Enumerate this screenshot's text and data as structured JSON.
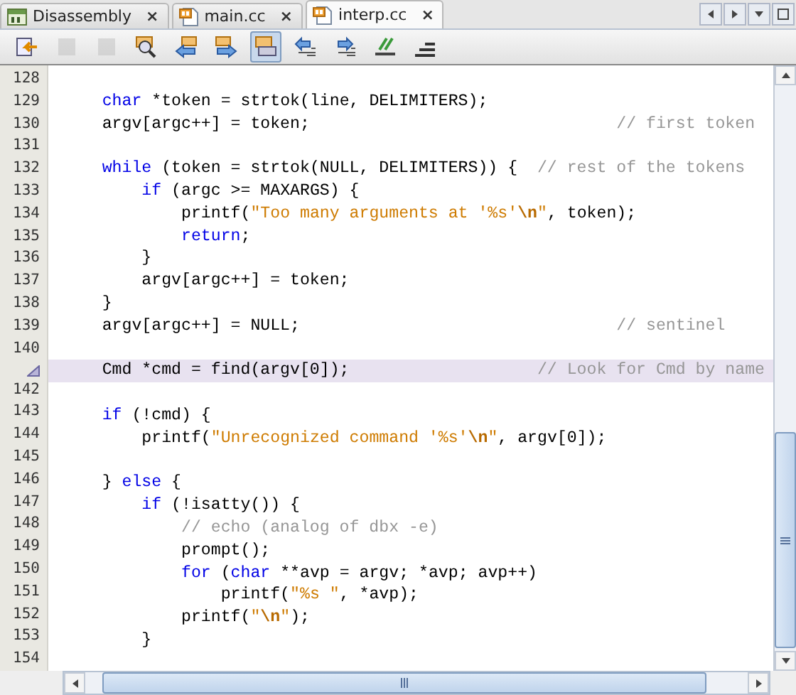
{
  "tabs": [
    {
      "label": "Disassembly",
      "kind": "disassembly",
      "selected": false,
      "close": "×"
    },
    {
      "label": "main.cc",
      "kind": "source",
      "selected": false,
      "close": "×"
    },
    {
      "label": "interp.cc",
      "kind": "source",
      "selected": true,
      "close": "×"
    }
  ],
  "editor": {
    "lines": [
      {
        "number": "128",
        "highlighted": false
      },
      {
        "number": "129",
        "highlighted": false,
        "segments": [
          {
            "kind": "keyword",
            "text": "    char"
          },
          {
            "kind": "plain",
            "text": " *token = strtok(line, DELIMITERS);"
          }
        ]
      },
      {
        "number": "130",
        "highlighted": false,
        "segments": [
          {
            "kind": "plain",
            "text": "    argv[argc++] = token;                               "
          },
          {
            "kind": "comment",
            "text": "// first token"
          }
        ]
      },
      {
        "number": "131",
        "highlighted": false
      },
      {
        "number": "132",
        "highlighted": false,
        "segments": [
          {
            "kind": "keyword",
            "text": "    while"
          },
          {
            "kind": "plain",
            "text": " (token = strtok(NULL, DELIMITERS)) {  "
          },
          {
            "kind": "comment",
            "text": "// rest of the tokens"
          }
        ]
      },
      {
        "number": "133",
        "highlighted": false,
        "segments": [
          {
            "kind": "keyword",
            "text": "        if"
          },
          {
            "kind": "plain",
            "text": " (argc >= MAXARGS) {"
          }
        ]
      },
      {
        "number": "134",
        "highlighted": false,
        "segments": [
          {
            "kind": "plain",
            "text": "            printf("
          },
          {
            "kind": "string",
            "text": "\"Too many arguments at '%s'"
          },
          {
            "kind": "escape",
            "text": "\\n"
          },
          {
            "kind": "string",
            "text": "\""
          },
          {
            "kind": "plain",
            "text": ", token);"
          }
        ]
      },
      {
        "number": "135",
        "highlighted": false,
        "segments": [
          {
            "kind": "keyword",
            "text": "            return"
          },
          {
            "kind": "plain",
            "text": ";"
          }
        ]
      },
      {
        "number": "136",
        "highlighted": false,
        "segments": [
          {
            "kind": "plain",
            "text": "        }"
          }
        ]
      },
      {
        "number": "137",
        "highlighted": false,
        "segments": [
          {
            "kind": "plain",
            "text": "        argv[argc++] = token;"
          }
        ]
      },
      {
        "number": "138",
        "highlighted": false,
        "segments": [
          {
            "kind": "plain",
            "text": "    }"
          }
        ]
      },
      {
        "number": "139",
        "highlighted": false,
        "segments": [
          {
            "kind": "plain",
            "text": "    argv[argc++] = NULL;                                "
          },
          {
            "kind": "comment",
            "text": "// sentinel"
          }
        ]
      },
      {
        "number": "140",
        "highlighted": false
      },
      {
        "highlighted": true,
        "segments": [
          {
            "kind": "plain",
            "text": "    Cmd *cmd = find(argv[0]);                   "
          },
          {
            "kind": "comment",
            "text": "// Look for Cmd by name"
          }
        ]
      },
      {
        "number": "142",
        "highlighted": false
      },
      {
        "number": "143",
        "highlighted": false,
        "segments": [
          {
            "kind": "keyword",
            "text": "    if"
          },
          {
            "kind": "plain",
            "text": " (!cmd) {"
          }
        ]
      },
      {
        "number": "144",
        "highlighted": false,
        "segments": [
          {
            "kind": "plain",
            "text": "        printf("
          },
          {
            "kind": "string",
            "text": "\"Unrecognized command '%s'"
          },
          {
            "kind": "escape",
            "text": "\\n"
          },
          {
            "kind": "string",
            "text": "\""
          },
          {
            "kind": "plain",
            "text": ", argv[0]);"
          }
        ]
      },
      {
        "number": "145",
        "highlighted": false
      },
      {
        "number": "146",
        "highlighted": false,
        "segments": [
          {
            "kind": "plain",
            "text": "    } "
          },
          {
            "kind": "keyword",
            "text": "else"
          },
          {
            "kind": "plain",
            "text": " {"
          }
        ]
      },
      {
        "number": "147",
        "highlighted": false,
        "segments": [
          {
            "kind": "keyword",
            "text": "        if"
          },
          {
            "kind": "plain",
            "text": " (!isatty()) {"
          }
        ]
      },
      {
        "number": "148",
        "highlighted": false,
        "segments": [
          {
            "kind": "comment",
            "text": "            // echo (analog of dbx -e)"
          }
        ]
      },
      {
        "number": "149",
        "highlighted": false,
        "segments": [
          {
            "kind": "plain",
            "text": "            prompt();"
          }
        ]
      },
      {
        "number": "150",
        "highlighted": false,
        "segments": [
          {
            "kind": "keyword",
            "text": "            for"
          },
          {
            "kind": "plain",
            "text": " ("
          },
          {
            "kind": "keyword",
            "text": "char"
          },
          {
            "kind": "plain",
            "text": " **avp = argv; *avp; avp++)"
          }
        ]
      },
      {
        "number": "151",
        "highlighted": false,
        "segments": [
          {
            "kind": "plain",
            "text": "                printf("
          },
          {
            "kind": "string",
            "text": "\"%s \""
          },
          {
            "kind": "plain",
            "text": ", *avp);"
          }
        ]
      },
      {
        "number": "152",
        "highlighted": false,
        "segments": [
          {
            "kind": "plain",
            "text": "            printf("
          },
          {
            "kind": "string",
            "text": "\""
          },
          {
            "kind": "escape",
            "text": "\\n"
          },
          {
            "kind": "string",
            "text": "\""
          },
          {
            "kind": "plain",
            "text": ");"
          }
        ]
      },
      {
        "number": "153",
        "highlighted": false,
        "segments": [
          {
            "kind": "plain",
            "text": "        }"
          }
        ]
      },
      {
        "number": "154",
        "highlighted": false
      }
    ]
  }
}
